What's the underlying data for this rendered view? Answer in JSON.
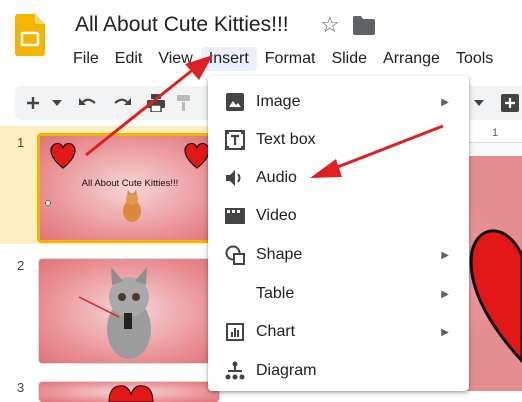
{
  "app": {
    "title": "All About Cute Kitties!!!",
    "logo_icon": "google-slides-logo",
    "accent_color": "#f4b400"
  },
  "menubar": {
    "items": [
      {
        "label": "File"
      },
      {
        "label": "Edit"
      },
      {
        "label": "View"
      },
      {
        "label": "Insert",
        "active": true
      },
      {
        "label": "Format"
      },
      {
        "label": "Slide"
      },
      {
        "label": "Arrange"
      },
      {
        "label": "Tools"
      }
    ]
  },
  "toolbar": {
    "icons": [
      "add-icon",
      "chevron-down-icon",
      "undo-icon",
      "redo-icon",
      "print-icon",
      "paint-format-icon",
      "chevron-down-icon",
      "add-comment-icon"
    ]
  },
  "insert_menu": {
    "items": [
      {
        "label": "Image",
        "icon": "image-icon",
        "submenu": true
      },
      {
        "label": "Text box",
        "icon": "text-box-icon",
        "submenu": false
      },
      {
        "label": "Audio",
        "icon": "audio-icon",
        "submenu": false
      },
      {
        "label": "Video",
        "icon": "video-icon",
        "submenu": false
      },
      {
        "label": "Shape",
        "icon": "shape-icon",
        "submenu": true
      },
      {
        "label": "Table",
        "icon": "",
        "submenu": true
      },
      {
        "label": "Chart",
        "icon": "chart-icon",
        "submenu": true
      },
      {
        "label": "Diagram",
        "icon": "diagram-icon",
        "submenu": false
      }
    ]
  },
  "slides": [
    {
      "number": "1",
      "title": "All About Cute Kitties!!!",
      "selected": true
    },
    {
      "number": "2",
      "selected": false
    },
    {
      "number": "3",
      "selected": false
    }
  ],
  "ruler": {
    "label": "1"
  },
  "annotation_color": "#e02020"
}
